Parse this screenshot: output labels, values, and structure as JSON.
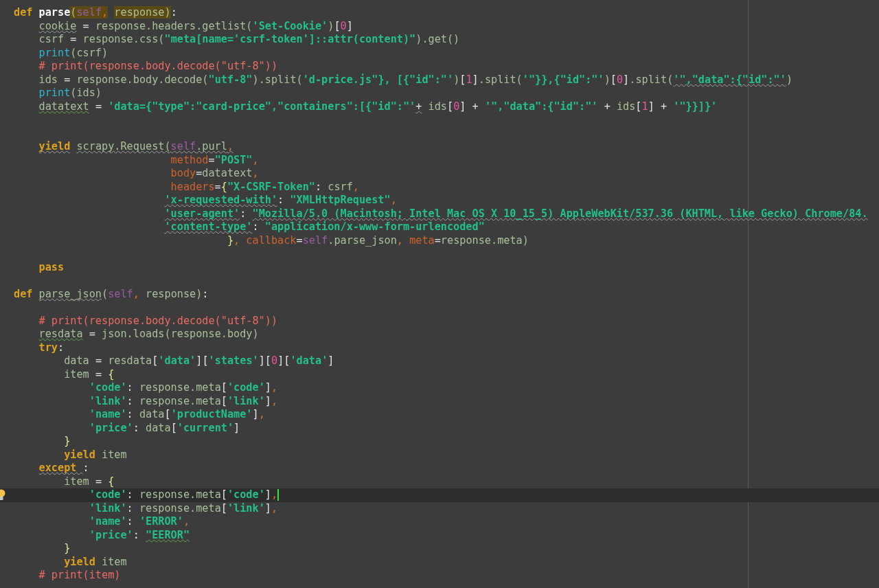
{
  "editor": {
    "lines": [
      {
        "current": false,
        "tokens": [
          {
            "kind": "keyword",
            "text": "def "
          },
          {
            "kind": "defname",
            "text": "parse"
          },
          {
            "kind": "plain",
            "text": "(",
            "highlighted": true
          },
          {
            "kind": "self",
            "text": "self",
            "highlighted": true
          },
          {
            "kind": "comma",
            "text": ",",
            "highlighted": true
          },
          {
            "kind": "plain",
            "text": " response",
            "highlighted": true
          },
          {
            "kind": "plain",
            "text": ")",
            "highlighted": true
          },
          {
            "kind": "op",
            "text": ":"
          }
        ]
      },
      {
        "current": false,
        "tokens": [
          {
            "kind": "plain",
            "text": "    cookie",
            "weak_warning": true
          },
          {
            "kind": "op",
            "text": " = "
          },
          {
            "kind": "plain",
            "text": "response.headers.getlist("
          },
          {
            "kind": "string",
            "text": "'Set-Cookie'"
          },
          {
            "kind": "plain",
            "text": ")"
          },
          {
            "kind": "op",
            "text": "["
          },
          {
            "kind": "number",
            "text": "0"
          },
          {
            "kind": "op",
            "text": "]"
          }
        ]
      },
      {
        "current": false,
        "tokens": [
          {
            "kind": "plain",
            "text": "    csrf"
          },
          {
            "kind": "op",
            "text": " = "
          },
          {
            "kind": "plain",
            "text": "response.css("
          },
          {
            "kind": "string",
            "text": "\"meta[name='csrf-token']::attr(content)\""
          },
          {
            "kind": "plain",
            "text": ").get()"
          }
        ]
      },
      {
        "current": false,
        "tokens": [
          {
            "kind": "builtin",
            "text": "    print"
          },
          {
            "kind": "plain",
            "text": "(csrf)"
          }
        ]
      },
      {
        "current": false,
        "tokens": [
          {
            "kind": "comment",
            "text": "    # print(response.body.decode(\"utf-8\"))"
          }
        ]
      },
      {
        "current": false,
        "tokens": [
          {
            "kind": "plain",
            "text": "    ids"
          },
          {
            "kind": "op",
            "text": " = "
          },
          {
            "kind": "plain",
            "text": "response.body.decode("
          },
          {
            "kind": "string",
            "text": "\"utf-8\""
          },
          {
            "kind": "plain",
            "text": ").split("
          },
          {
            "kind": "string",
            "text": "'d-price.js\"}, [{\"id\":\"'"
          },
          {
            "kind": "plain",
            "text": ")"
          },
          {
            "kind": "op",
            "text": "["
          },
          {
            "kind": "number",
            "text": "1"
          },
          {
            "kind": "op",
            "text": "]"
          },
          {
            "kind": "plain",
            "text": ".split("
          },
          {
            "kind": "string",
            "text": "'\"}},{\"id\":\"'"
          },
          {
            "kind": "plain",
            "text": ")"
          },
          {
            "kind": "op",
            "text": "["
          },
          {
            "kind": "number",
            "text": "0"
          },
          {
            "kind": "op",
            "text": "]"
          },
          {
            "kind": "plain",
            "text": ".split("
          },
          {
            "kind": "string",
            "text": "'\",\"data\":{\"id\":\"'",
            "weak_warning": true
          },
          {
            "kind": "plain",
            "text": ")"
          }
        ]
      },
      {
        "current": false,
        "tokens": [
          {
            "kind": "builtin",
            "text": "    print"
          },
          {
            "kind": "plain",
            "text": "(ids)"
          }
        ]
      },
      {
        "current": false,
        "tokens": [
          {
            "kind": "plain",
            "text": "    datatext",
            "typo": true
          },
          {
            "kind": "op",
            "text": " = "
          },
          {
            "kind": "string",
            "text": "'data={\"type\":\"card-price\",\"containers\":[{\"id\":\"'"
          },
          {
            "kind": "op",
            "text": "+",
            "weak_warning": true
          },
          {
            "kind": "plain",
            "text": " ids"
          },
          {
            "kind": "op",
            "text": "["
          },
          {
            "kind": "number",
            "text": "0"
          },
          {
            "kind": "op",
            "text": "] + "
          },
          {
            "kind": "string",
            "text": "'\",\"data\":{\"id\":\"'"
          },
          {
            "kind": "op",
            "text": " + "
          },
          {
            "kind": "plain",
            "text": "ids"
          },
          {
            "kind": "op",
            "text": "["
          },
          {
            "kind": "number",
            "text": "1"
          },
          {
            "kind": "op",
            "text": "] + "
          },
          {
            "kind": "string",
            "text": "'\"}}]}'"
          }
        ]
      },
      {
        "current": false
      },
      {
        "current": false
      },
      {
        "current": false,
        "tokens": [
          {
            "kind": "keyword",
            "text": "    yield",
            "weak_warning": true
          },
          {
            "kind": "plain",
            "text": " scrapy.Request(",
            "weak_warning": true
          },
          {
            "kind": "self",
            "text": "self",
            "weak_warning": true
          },
          {
            "kind": "plain",
            "text": ".purl",
            "weak_warning": true
          },
          {
            "kind": "comma",
            "text": ",",
            "weak_warning": true
          }
        ]
      },
      {
        "current": false,
        "tokens": [
          {
            "kind": "kwarg",
            "text": "                         method"
          },
          {
            "kind": "op",
            "text": "="
          },
          {
            "kind": "string",
            "text": "\"POST\""
          },
          {
            "kind": "comma",
            "text": ","
          }
        ]
      },
      {
        "current": false,
        "tokens": [
          {
            "kind": "kwarg",
            "text": "                         body"
          },
          {
            "kind": "op",
            "text": "="
          },
          {
            "kind": "plain",
            "text": "datatext"
          },
          {
            "kind": "comma",
            "text": ","
          }
        ]
      },
      {
        "current": false,
        "tokens": [
          {
            "kind": "kwarg",
            "text": "                         headers"
          },
          {
            "kind": "op",
            "text": "="
          },
          {
            "kind": "brace",
            "text": "{"
          },
          {
            "kind": "string",
            "text": "\"X-CSRF-Token\""
          },
          {
            "kind": "op",
            "text": ": "
          },
          {
            "kind": "plain",
            "text": "csrf"
          },
          {
            "kind": "comma",
            "text": ","
          }
        ]
      },
      {
        "current": false,
        "tokens": [
          {
            "kind": "string",
            "text": "                        'x-requested-with'",
            "weak_warning": true
          },
          {
            "kind": "op",
            "text": ": "
          },
          {
            "kind": "string",
            "text": "\"XMLHttpRequest\""
          },
          {
            "kind": "comma",
            "text": ","
          }
        ]
      },
      {
        "current": false,
        "tokens": [
          {
            "kind": "string",
            "text": "                        'user-agent'",
            "weak_warning": true
          },
          {
            "kind": "op",
            "text": ": "
          },
          {
            "kind": "string",
            "text": "\"Mozilla/5.0 (Macintosh; Intel Mac OS X 10_15_5) AppleWebKit/537.36 (KHTML, like Gecko) Chrome/84.",
            "weak_warning": true
          }
        ]
      },
      {
        "current": false,
        "tokens": [
          {
            "kind": "string",
            "text": "                        'content-type'",
            "weak_warning": true
          },
          {
            "kind": "op",
            "text": ": "
          },
          {
            "kind": "string",
            "text": "\"application/x-www-form-urlencoded\""
          }
        ]
      },
      {
        "current": false,
        "tokens": [
          {
            "kind": "brace",
            "text": "                                  }"
          },
          {
            "kind": "comma",
            "text": ", "
          },
          {
            "kind": "kwarg",
            "text": "callback"
          },
          {
            "kind": "op",
            "text": "="
          },
          {
            "kind": "self",
            "text": "self"
          },
          {
            "kind": "plain",
            "text": ".parse_json"
          },
          {
            "kind": "comma",
            "text": ", "
          },
          {
            "kind": "kwarg",
            "text": "meta"
          },
          {
            "kind": "op",
            "text": "="
          },
          {
            "kind": "plain",
            "text": "response.meta)"
          }
        ]
      },
      {
        "current": false
      },
      {
        "current": false,
        "tokens": [
          {
            "kind": "keyword",
            "text": "    pass"
          }
        ]
      },
      {
        "current": false
      },
      {
        "current": false,
        "tokens": [
          {
            "kind": "keyword",
            "text": "def "
          },
          {
            "kind": "plain",
            "text": "parse_json",
            "weak_warning": true
          },
          {
            "kind": "plain",
            "text": "("
          },
          {
            "kind": "self",
            "text": "self"
          },
          {
            "kind": "comma",
            "text": ","
          },
          {
            "kind": "plain",
            "text": " response)"
          },
          {
            "kind": "op",
            "text": ":"
          }
        ]
      },
      {
        "current": false
      },
      {
        "current": false,
        "tokens": [
          {
            "kind": "comment",
            "text": "    # print(response.body.decode(\"utf-8\"))"
          }
        ]
      },
      {
        "current": false,
        "tokens": [
          {
            "kind": "plain",
            "text": "    resdata",
            "typo": true
          },
          {
            "kind": "op",
            "text": " = "
          },
          {
            "kind": "plain",
            "text": "json.loads(response.body)"
          }
        ]
      },
      {
        "current": false,
        "tokens": [
          {
            "kind": "keyword",
            "text": "    try"
          },
          {
            "kind": "op",
            "text": ":"
          }
        ]
      },
      {
        "current": false,
        "tokens": [
          {
            "kind": "plain",
            "text": "        data"
          },
          {
            "kind": "op",
            "text": " = "
          },
          {
            "kind": "plain",
            "text": "resdata"
          },
          {
            "kind": "op",
            "text": "["
          },
          {
            "kind": "string",
            "text": "'data'"
          },
          {
            "kind": "op",
            "text": "]["
          },
          {
            "kind": "string",
            "text": "'states'"
          },
          {
            "kind": "op",
            "text": "]["
          },
          {
            "kind": "number",
            "text": "0"
          },
          {
            "kind": "op",
            "text": "]["
          },
          {
            "kind": "string",
            "text": "'data'"
          },
          {
            "kind": "op",
            "text": "]"
          }
        ]
      },
      {
        "current": false,
        "tokens": [
          {
            "kind": "plain",
            "text": "        item"
          },
          {
            "kind": "op",
            "text": " = "
          },
          {
            "kind": "brace",
            "text": "{"
          }
        ]
      },
      {
        "current": false,
        "tokens": [
          {
            "kind": "string",
            "text": "            'code'"
          },
          {
            "kind": "op",
            "text": ": "
          },
          {
            "kind": "plain",
            "text": "response.meta"
          },
          {
            "kind": "op",
            "text": "["
          },
          {
            "kind": "string",
            "text": "'code'"
          },
          {
            "kind": "op",
            "text": "]"
          },
          {
            "kind": "comma",
            "text": ","
          }
        ]
      },
      {
        "current": false,
        "tokens": [
          {
            "kind": "string",
            "text": "            'link'"
          },
          {
            "kind": "op",
            "text": ": "
          },
          {
            "kind": "plain",
            "text": "response.meta"
          },
          {
            "kind": "op",
            "text": "["
          },
          {
            "kind": "string",
            "text": "'link'"
          },
          {
            "kind": "op",
            "text": "]"
          },
          {
            "kind": "comma",
            "text": ","
          }
        ]
      },
      {
        "current": false,
        "tokens": [
          {
            "kind": "string",
            "text": "            'name'"
          },
          {
            "kind": "op",
            "text": ": "
          },
          {
            "kind": "plain",
            "text": "data"
          },
          {
            "kind": "op",
            "text": "["
          },
          {
            "kind": "string",
            "text": "'productName'"
          },
          {
            "kind": "op",
            "text": "]"
          },
          {
            "kind": "comma",
            "text": ","
          }
        ]
      },
      {
        "current": false,
        "tokens": [
          {
            "kind": "string",
            "text": "            'price'"
          },
          {
            "kind": "op",
            "text": ": "
          },
          {
            "kind": "plain",
            "text": "data"
          },
          {
            "kind": "op",
            "text": "["
          },
          {
            "kind": "string",
            "text": "'current'"
          },
          {
            "kind": "op",
            "text": "]"
          }
        ]
      },
      {
        "current": false,
        "tokens": [
          {
            "kind": "brace",
            "text": "        }"
          }
        ]
      },
      {
        "current": false,
        "tokens": [
          {
            "kind": "keyword",
            "text": "        yield"
          },
          {
            "kind": "plain",
            "text": " item"
          }
        ]
      },
      {
        "current": false,
        "tokens": [
          {
            "kind": "keyword",
            "text": "    except ",
            "weak_warning": true
          },
          {
            "kind": "op",
            "text": ":"
          }
        ]
      },
      {
        "current": false,
        "tokens": [
          {
            "kind": "plain",
            "text": "        item"
          },
          {
            "kind": "op",
            "text": " = "
          },
          {
            "kind": "brace",
            "text": "{"
          }
        ]
      },
      {
        "current": true,
        "tokens": [
          {
            "kind": "string",
            "text": "            'code'"
          },
          {
            "kind": "op",
            "text": ": "
          },
          {
            "kind": "plain",
            "text": "response.meta"
          },
          {
            "kind": "op",
            "text": "["
          },
          {
            "kind": "string",
            "text": "'code'"
          },
          {
            "kind": "op",
            "text": "]"
          },
          {
            "kind": "comma",
            "text": ","
          }
        ]
      },
      {
        "current": false,
        "tokens": [
          {
            "kind": "string",
            "text": "            'link'"
          },
          {
            "kind": "op",
            "text": ": "
          },
          {
            "kind": "plain",
            "text": "response.meta"
          },
          {
            "kind": "op",
            "text": "["
          },
          {
            "kind": "string",
            "text": "'link'"
          },
          {
            "kind": "op",
            "text": "]"
          },
          {
            "kind": "comma",
            "text": ","
          }
        ]
      },
      {
        "current": false,
        "tokens": [
          {
            "kind": "string",
            "text": "            'name'"
          },
          {
            "kind": "op",
            "text": ": "
          },
          {
            "kind": "string",
            "text": "'ERROR'"
          },
          {
            "kind": "comma",
            "text": ","
          }
        ]
      },
      {
        "current": false,
        "tokens": [
          {
            "kind": "string",
            "text": "            'price'"
          },
          {
            "kind": "op",
            "text": ": "
          },
          {
            "kind": "string",
            "text": "\"EEROR\"",
            "typo": true
          }
        ]
      },
      {
        "current": false,
        "tokens": [
          {
            "kind": "brace",
            "text": "        }"
          }
        ]
      },
      {
        "current": false,
        "tokens": [
          {
            "kind": "keyword",
            "text": "        yield"
          },
          {
            "kind": "plain",
            "text": " item"
          }
        ]
      },
      {
        "current": false,
        "tokens": [
          {
            "kind": "comment",
            "text": "    # print(item)"
          }
        ]
      }
    ]
  }
}
